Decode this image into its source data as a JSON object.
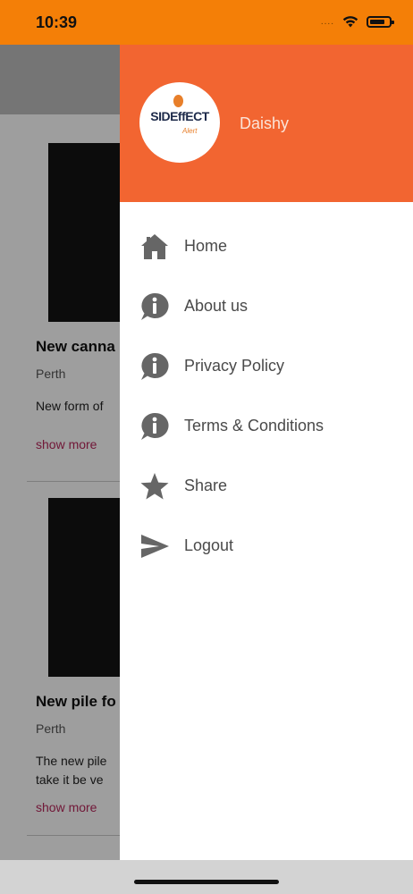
{
  "status_bar": {
    "time": "10:39",
    "signal": "....",
    "color": "#f47f07"
  },
  "feed": [
    {
      "title": "New canna",
      "location": "Perth",
      "description": "New form of",
      "more": "show more"
    },
    {
      "title": "New pile fo",
      "location": "Perth",
      "description": "The new pile\ntake it be ve",
      "more": "show more"
    }
  ],
  "drawer": {
    "header_color": "#f26531",
    "logo": {
      "main": "SIDEffECT",
      "sub": "Alert"
    },
    "user_name": "Daishy",
    "menu": [
      {
        "label": "Home",
        "icon": "home-icon"
      },
      {
        "label": "About us",
        "icon": "info-bubble-icon"
      },
      {
        "label": "Privacy Policy",
        "icon": "info-bubble-icon"
      },
      {
        "label": "Terms & Conditions",
        "icon": "info-bubble-icon"
      },
      {
        "label": "Share",
        "icon": "star-icon"
      },
      {
        "label": "Logout",
        "icon": "send-icon"
      }
    ]
  }
}
